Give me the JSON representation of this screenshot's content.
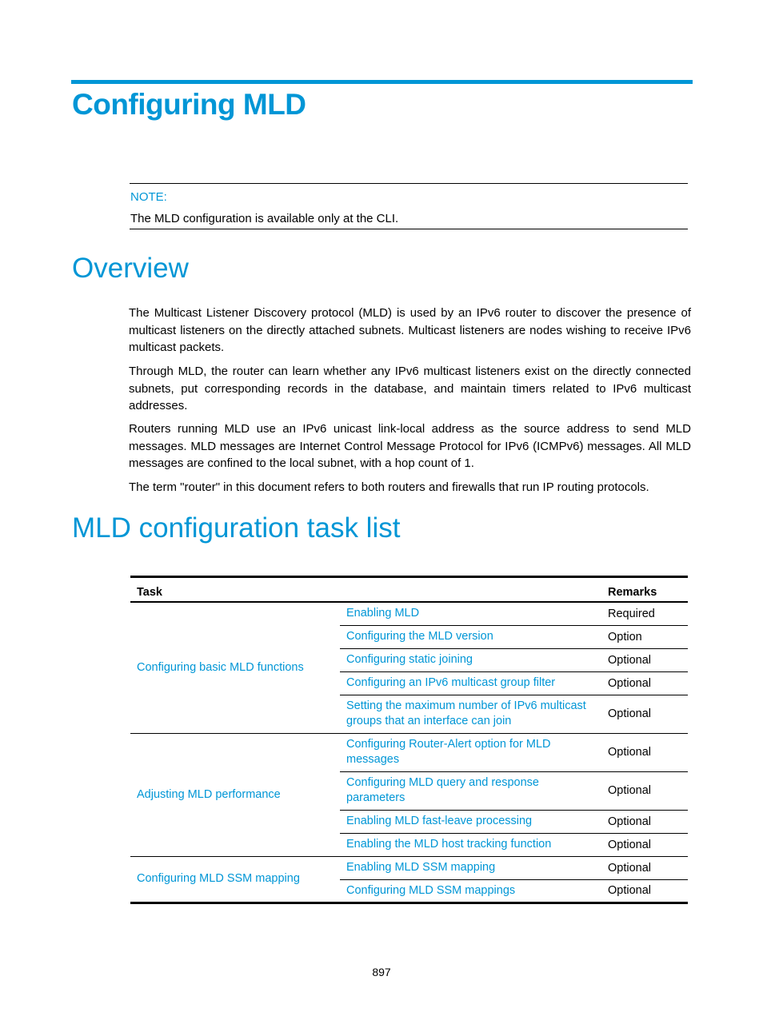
{
  "chapter": {
    "title": "Configuring MLD"
  },
  "note": {
    "label": "NOTE:",
    "text": "The MLD configuration is available only at the CLI."
  },
  "overview": {
    "heading": "Overview",
    "paragraphs": [
      "The Multicast Listener Discovery protocol (MLD) is used by an IPv6 router to discover the presence of multicast listeners on the directly attached subnets. Multicast listeners are nodes wishing to receive IPv6 multicast packets.",
      "Through MLD, the router can learn whether any IPv6 multicast listeners exist on the directly connected subnets, put corresponding records in the database, and maintain timers related to IPv6 multicast addresses.",
      "Routers running MLD use an IPv6 unicast link-local address as the source address to send MLD messages. MLD messages are Internet Control Message Protocol for IPv6 (ICMPv6) messages. All MLD messages are confined to the local subnet, with a hop count of 1.",
      "The term \"router\" in this document refers to both routers and firewalls that run IP routing protocols."
    ]
  },
  "task_list": {
    "heading": "MLD configuration task list",
    "columns": {
      "task": "Task",
      "remarks": "Remarks"
    },
    "groups": [
      {
        "label": "Configuring basic MLD functions",
        "rows": [
          {
            "task": "Enabling MLD",
            "remarks": "Required"
          },
          {
            "task": "Configuring the MLD version",
            "remarks": "Option"
          },
          {
            "task": "Configuring static joining",
            "remarks": "Optional"
          },
          {
            "task": "Configuring an IPv6 multicast group filter",
            "remarks": "Optional"
          },
          {
            "task": "Setting the maximum number of IPv6 multicast groups that an interface can join",
            "remarks": "Optional"
          }
        ]
      },
      {
        "label": "Adjusting MLD performance",
        "rows": [
          {
            "task": "Configuring Router-Alert option for MLD messages",
            "remarks": "Optional"
          },
          {
            "task": "Configuring MLD query and response parameters",
            "remarks": "Optional"
          },
          {
            "task": "Enabling MLD fast-leave processing",
            "remarks": "Optional"
          },
          {
            "task": "Enabling the MLD host tracking function",
            "remarks": "Optional"
          }
        ]
      },
      {
        "label": "Configuring MLD SSM mapping",
        "rows": [
          {
            "task": "Enabling MLD SSM mapping",
            "remarks": "Optional"
          },
          {
            "task": "Configuring MLD SSM mappings",
            "remarks": "Optional"
          }
        ]
      }
    ]
  },
  "footer": {
    "page_number": "897"
  }
}
